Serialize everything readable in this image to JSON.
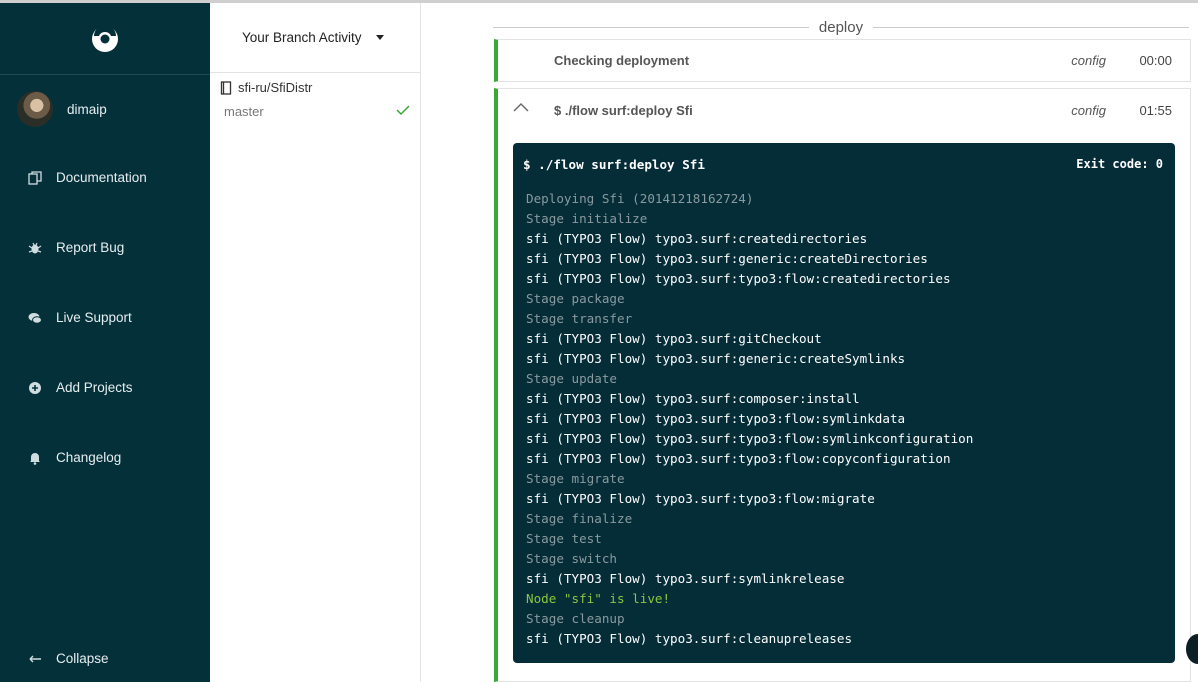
{
  "sidebar": {
    "user": "dimaip",
    "nav": [
      {
        "label": "Documentation",
        "icon": "docs-icon"
      },
      {
        "label": "Report Bug",
        "icon": "bug-icon"
      },
      {
        "label": "Live Support",
        "icon": "chat-icon"
      },
      {
        "label": "Add Projects",
        "icon": "plus-circle-icon"
      },
      {
        "label": "Changelog",
        "icon": "bell-icon"
      }
    ],
    "collapse": "Collapse"
  },
  "branches": {
    "header": "Your Branch Activity",
    "repo": "sfi-ru/SfiDistr",
    "branch": "master"
  },
  "main": {
    "section_label": "deploy",
    "steps": [
      {
        "title": "Checking deployment",
        "config": "config",
        "time": "00:00"
      },
      {
        "title": "$ ./flow surf:deploy Sfi",
        "config": "config",
        "time": "01:55"
      }
    ],
    "terminal": {
      "command": "$ ./flow surf:deploy Sfi",
      "exit": "Exit code: 0",
      "lines": [
        {
          "t": "Deploying Sfi (20141218162724)",
          "k": "dim"
        },
        {
          "t": "Stage initialize",
          "k": "dim"
        },
        {
          "t": "sfi (TYPO3 Flow) typo3.surf:createdirectories",
          "k": "main"
        },
        {
          "t": "sfi (TYPO3 Flow) typo3.surf:generic:createDirectories",
          "k": "main"
        },
        {
          "t": "sfi (TYPO3 Flow) typo3.surf:typo3:flow:createdirectories",
          "k": "main"
        },
        {
          "t": "Stage package",
          "k": "dim"
        },
        {
          "t": "Stage transfer",
          "k": "dim"
        },
        {
          "t": "sfi (TYPO3 Flow) typo3.surf:gitCheckout",
          "k": "main"
        },
        {
          "t": "sfi (TYPO3 Flow) typo3.surf:generic:createSymlinks",
          "k": "main"
        },
        {
          "t": "Stage update",
          "k": "dim"
        },
        {
          "t": "sfi (TYPO3 Flow) typo3.surf:composer:install",
          "k": "main"
        },
        {
          "t": "sfi (TYPO3 Flow) typo3.surf:typo3:flow:symlinkdata",
          "k": "main"
        },
        {
          "t": "sfi (TYPO3 Flow) typo3.surf:typo3:flow:symlinkconfiguration",
          "k": "main"
        },
        {
          "t": "sfi (TYPO3 Flow) typo3.surf:typo3:flow:copyconfiguration",
          "k": "main"
        },
        {
          "t": "Stage migrate",
          "k": "dim"
        },
        {
          "t": "sfi (TYPO3 Flow) typo3.surf:typo3:flow:migrate",
          "k": "main"
        },
        {
          "t": "Stage finalize",
          "k": "dim"
        },
        {
          "t": "Stage test",
          "k": "dim"
        },
        {
          "t": "Stage switch",
          "k": "dim"
        },
        {
          "t": "sfi (TYPO3 Flow) typo3.surf:symlinkrelease",
          "k": "main"
        },
        {
          "t": "Node \"sfi\" is live!",
          "k": "ok"
        },
        {
          "t": "Stage cleanup",
          "k": "dim"
        },
        {
          "t": "sfi (TYPO3 Flow) typo3.surf:cleanupreleases",
          "k": "main"
        }
      ]
    }
  },
  "colors": {
    "sidebar_bg": "#04303a",
    "success": "#39a935",
    "terminal_bg": "#042d38"
  }
}
